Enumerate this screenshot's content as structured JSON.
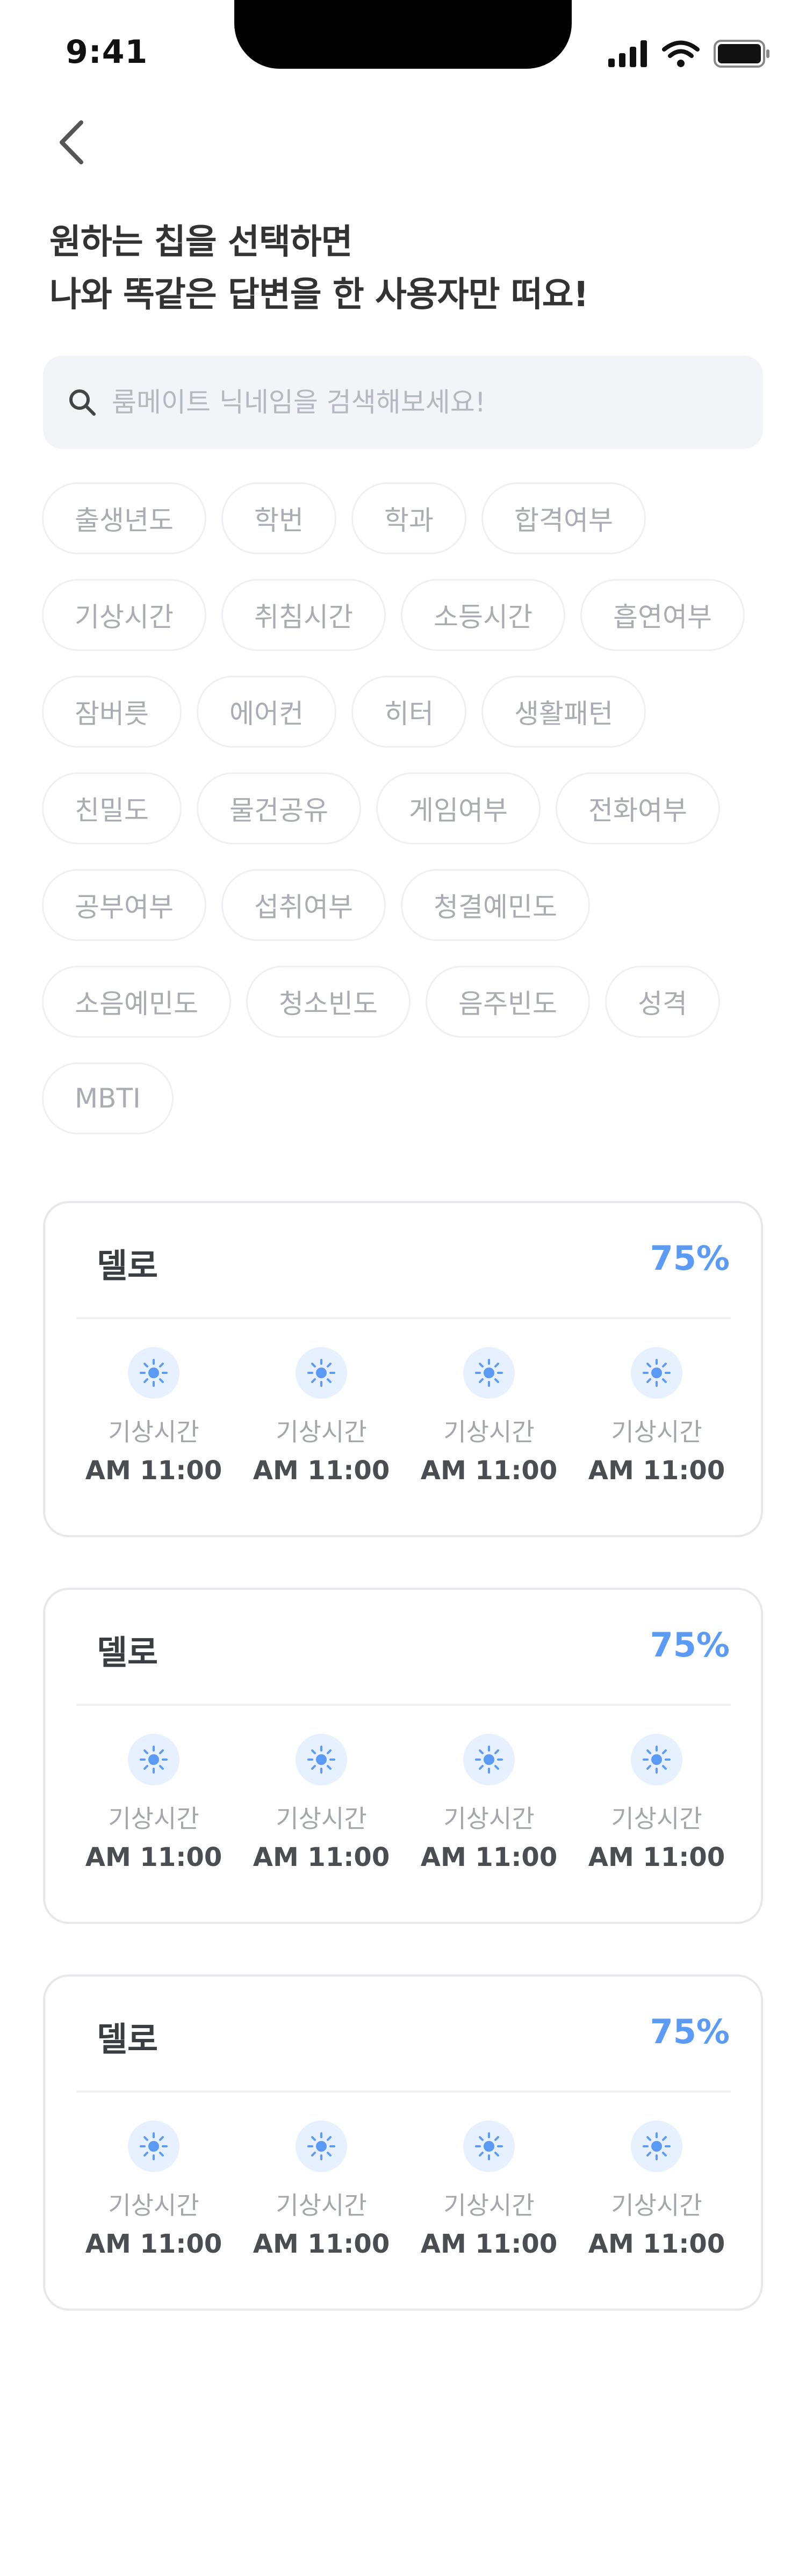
{
  "status_bar": {
    "time": "9:41"
  },
  "header": {
    "back_icon": "chevron-left-icon"
  },
  "title": {
    "line1": "원하는 칩을 선택하면",
    "line2": "나와 똑같은 답변을 한 사용자만 떠요!"
  },
  "search": {
    "placeholder": "룸메이트 닉네임을 검색해보세요!",
    "value": ""
  },
  "chips": [
    "출생년도",
    "학번",
    "학과",
    "합격여부",
    "기상시간",
    "취침시간",
    "소등시간",
    "흡연여부",
    "잠버릇",
    "에어컨",
    "히터",
    "생활패턴",
    "친밀도",
    "물건공유",
    "게임여부",
    "전화여부",
    "공부여부",
    "섭취여부",
    "청결예민도",
    "소음예민도",
    "청소빈도",
    "음주빈도",
    "성격",
    "MBTI"
  ],
  "cards": [
    {
      "name": "델로",
      "percent": "75%",
      "items": [
        {
          "icon": "sun-icon",
          "label": "기상시간",
          "value": "AM 11:00"
        },
        {
          "icon": "sun-icon",
          "label": "기상시간",
          "value": "AM 11:00"
        },
        {
          "icon": "sun-icon",
          "label": "기상시간",
          "value": "AM 11:00"
        },
        {
          "icon": "sun-icon",
          "label": "기상시간",
          "value": "AM 11:00"
        }
      ]
    },
    {
      "name": "델로",
      "percent": "75%",
      "items": [
        {
          "icon": "sun-icon",
          "label": "기상시간",
          "value": "AM 11:00"
        },
        {
          "icon": "sun-icon",
          "label": "기상시간",
          "value": "AM 11:00"
        },
        {
          "icon": "sun-icon",
          "label": "기상시간",
          "value": "AM 11:00"
        },
        {
          "icon": "sun-icon",
          "label": "기상시간",
          "value": "AM 11:00"
        }
      ]
    },
    {
      "name": "델로",
      "percent": "75%",
      "items": [
        {
          "icon": "sun-icon",
          "label": "기상시간",
          "value": "AM 11:00"
        },
        {
          "icon": "sun-icon",
          "label": "기상시간",
          "value": "AM 11:00"
        },
        {
          "icon": "sun-icon",
          "label": "기상시간",
          "value": "AM 11:00"
        },
        {
          "icon": "sun-icon",
          "label": "기상시간",
          "value": "AM 11:00"
        }
      ]
    }
  ],
  "colors": {
    "accent": "#5b9bf5",
    "chip_text": "#a9adb3",
    "chip_border": "#eef0f3",
    "search_bg": "#f2f4f8",
    "sun_bg": "#e7f0fe"
  }
}
